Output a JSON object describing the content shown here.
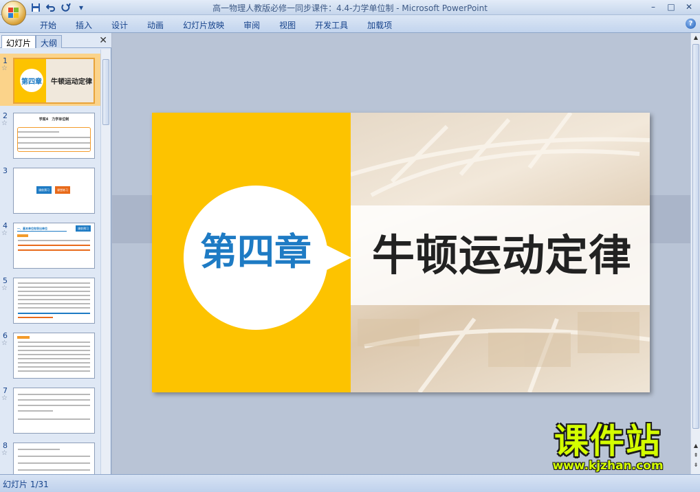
{
  "window": {
    "title": "高一物理人教版必修一同步课件：4.4-力学单位制 - Microsoft PowerPoint"
  },
  "quick_access": [
    "save-icon",
    "undo-icon",
    "redo-icon",
    "customize-icon"
  ],
  "ribbon": {
    "tabs": [
      {
        "label": "开始"
      },
      {
        "label": "插入"
      },
      {
        "label": "设计"
      },
      {
        "label": "动画"
      },
      {
        "label": "幻灯片放映"
      },
      {
        "label": "审阅"
      },
      {
        "label": "视图"
      },
      {
        "label": "开发工具"
      },
      {
        "label": "加载项"
      }
    ]
  },
  "left_panel": {
    "tab_slides": "幻灯片",
    "tab_outline": "大纲",
    "thumbnails": [
      {
        "num": "1",
        "title_left": "第四章",
        "title_right": "牛顿运动定律"
      },
      {
        "num": "2",
        "title": "学案4　力学单位制"
      },
      {
        "num": "3",
        "btn_left": "课前预习",
        "btn_right": "课堂练习"
      },
      {
        "num": "4",
        "heading": "一、基本单位和导出单位",
        "btn": "课前预习"
      },
      {
        "num": "5"
      },
      {
        "num": "6"
      },
      {
        "num": "7"
      },
      {
        "num": "8"
      }
    ]
  },
  "slide": {
    "chapter": "第四章",
    "title": "牛顿运动定律"
  },
  "status": {
    "slide_counter": "幻灯片 1/31"
  },
  "watermark": {
    "text": "课件站",
    "url": "www.kjzhan.com"
  },
  "colors": {
    "accent_yellow": "#fdc300",
    "chapter_blue": "#1e7bc4",
    "ribbon_text": "#15428b"
  }
}
